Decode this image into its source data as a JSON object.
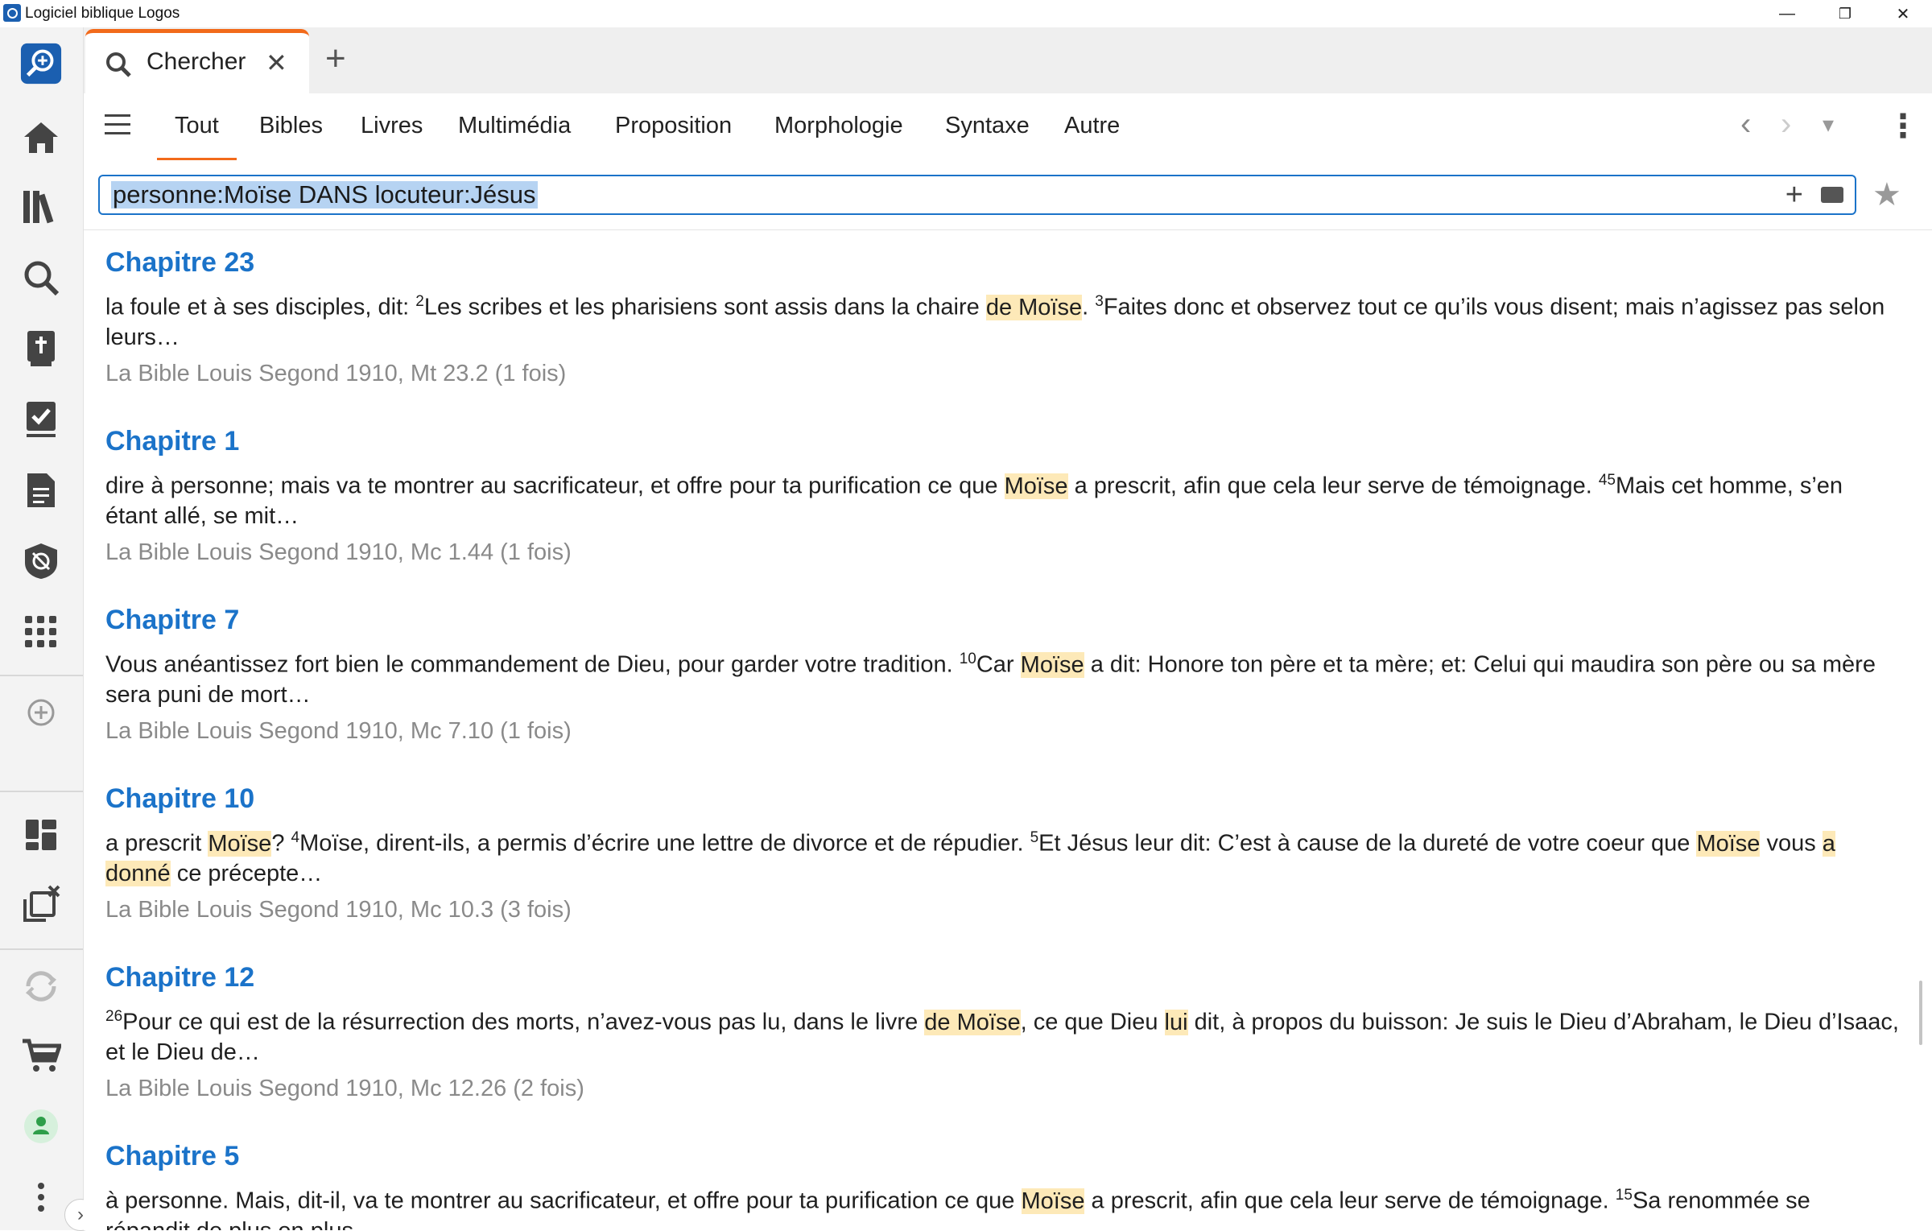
{
  "window": {
    "title": "Logiciel biblique Logos",
    "minimize": "—",
    "restore": "❐",
    "close": "✕"
  },
  "rail": {
    "icons": [
      "search-launcher-icon",
      "home-icon",
      "library-icon",
      "search-icon",
      "bible-icon",
      "checklist-icon",
      "document-icon",
      "shield-icon",
      "apps-grid-icon",
      "add-circle-icon",
      "layouts-icon",
      "close-panels-icon",
      "sync-icon",
      "cart-icon",
      "user-icon",
      "more-vertical-icon"
    ],
    "expand_label": "›"
  },
  "tab": {
    "label": "Chercher",
    "close": "✕",
    "new_tab": "+"
  },
  "nav": {
    "tabs": [
      "Tout",
      "Bibles",
      "Livres",
      "Multimédia",
      "Proposition",
      "Morphologie",
      "Syntaxe",
      "Autre"
    ],
    "active": "Tout",
    "back": "‹",
    "forward": "›",
    "dropdown": "▾",
    "more": "⋮"
  },
  "search": {
    "query": "personne:Moïse DANS locuteur:Jésus",
    "add": "+",
    "star": "★"
  },
  "results": [
    {
      "heading": "Chapitre 23",
      "parts": [
        {
          "t": "la foule et à ses disciples, dit: "
        },
        {
          "sup": "2"
        },
        {
          "t": "Les scribes et les pharisiens sont assis dans la chaire "
        },
        {
          "h": "de Moïse"
        },
        {
          "t": ". "
        },
        {
          "sup": "3"
        },
        {
          "t": "Faites donc et observez tout ce qu’ils vous disent; mais n’agissez pas selon leurs…"
        }
      ],
      "source": "La Bible Louis Segond 1910, Mt 23.2 (1 fois)"
    },
    {
      "heading": "Chapitre 1",
      "parts": [
        {
          "t": "dire à personne; mais va te montrer au sacrificateur, et offre pour ta purification ce que "
        },
        {
          "h": "Moïse"
        },
        {
          "t": " a prescrit, afin que cela leur serve de témoignage. "
        },
        {
          "sup": "45"
        },
        {
          "t": "Mais cet homme, s’en étant allé, se mit…"
        }
      ],
      "source": "La Bible Louis Segond 1910, Mc 1.44 (1 fois)"
    },
    {
      "heading": "Chapitre 7",
      "parts": [
        {
          "t": "Vous anéantissez fort bien le commandement de Dieu, pour garder votre tradition. "
        },
        {
          "sup": "10"
        },
        {
          "t": "Car "
        },
        {
          "h": "Moïse"
        },
        {
          "t": " a dit: Honore ton père et ta mère; et: Celui qui maudira son père ou sa mère sera puni de mort…"
        }
      ],
      "source": "La Bible Louis Segond 1910, Mc 7.10 (1 fois)"
    },
    {
      "heading": "Chapitre 10",
      "parts": [
        {
          "t": "a prescrit "
        },
        {
          "h": "Moïse"
        },
        {
          "t": "? "
        },
        {
          "sup": "4"
        },
        {
          "t": "Moïse, dirent-ils, a permis d’écrire une lettre de divorce et de répudier. "
        },
        {
          "sup": "5"
        },
        {
          "t": "Et Jésus leur dit: C’est à cause de la dureté de votre coeur que "
        },
        {
          "h": "Moïse"
        },
        {
          "t": " vous "
        },
        {
          "h": "a donné"
        },
        {
          "t": " ce précepte…"
        }
      ],
      "source": "La Bible Louis Segond 1910, Mc 10.3 (3 fois)"
    },
    {
      "heading": "Chapitre 12",
      "parts": [
        {
          "sup": "26"
        },
        {
          "t": "Pour ce qui est de la résurrection des morts, n’avez-vous pas lu, dans le livre "
        },
        {
          "h": "de Moïse"
        },
        {
          "t": ", ce que Dieu "
        },
        {
          "h": "lui"
        },
        {
          "t": " dit, à propos du buisson: Je suis le Dieu d’Abraham, le Dieu d’Isaac, et le Dieu de…"
        }
      ],
      "source": "La Bible Louis Segond 1910, Mc 12.26 (2 fois)"
    },
    {
      "heading": "Chapitre 5",
      "parts": [
        {
          "t": "à personne. Mais, dit-il, va te montrer au sacrificateur, et offre pour ta purification ce que "
        },
        {
          "h": "Moïse"
        },
        {
          "t": " a prescrit, afin que cela leur serve de témoignage. "
        },
        {
          "sup": "15"
        },
        {
          "t": "Sa renommée se répandit de plus en plus…"
        }
      ],
      "source": ""
    }
  ],
  "colors": {
    "accent": "#f26a1b",
    "link": "#1b73c9",
    "highlight": "#fde9b8"
  }
}
